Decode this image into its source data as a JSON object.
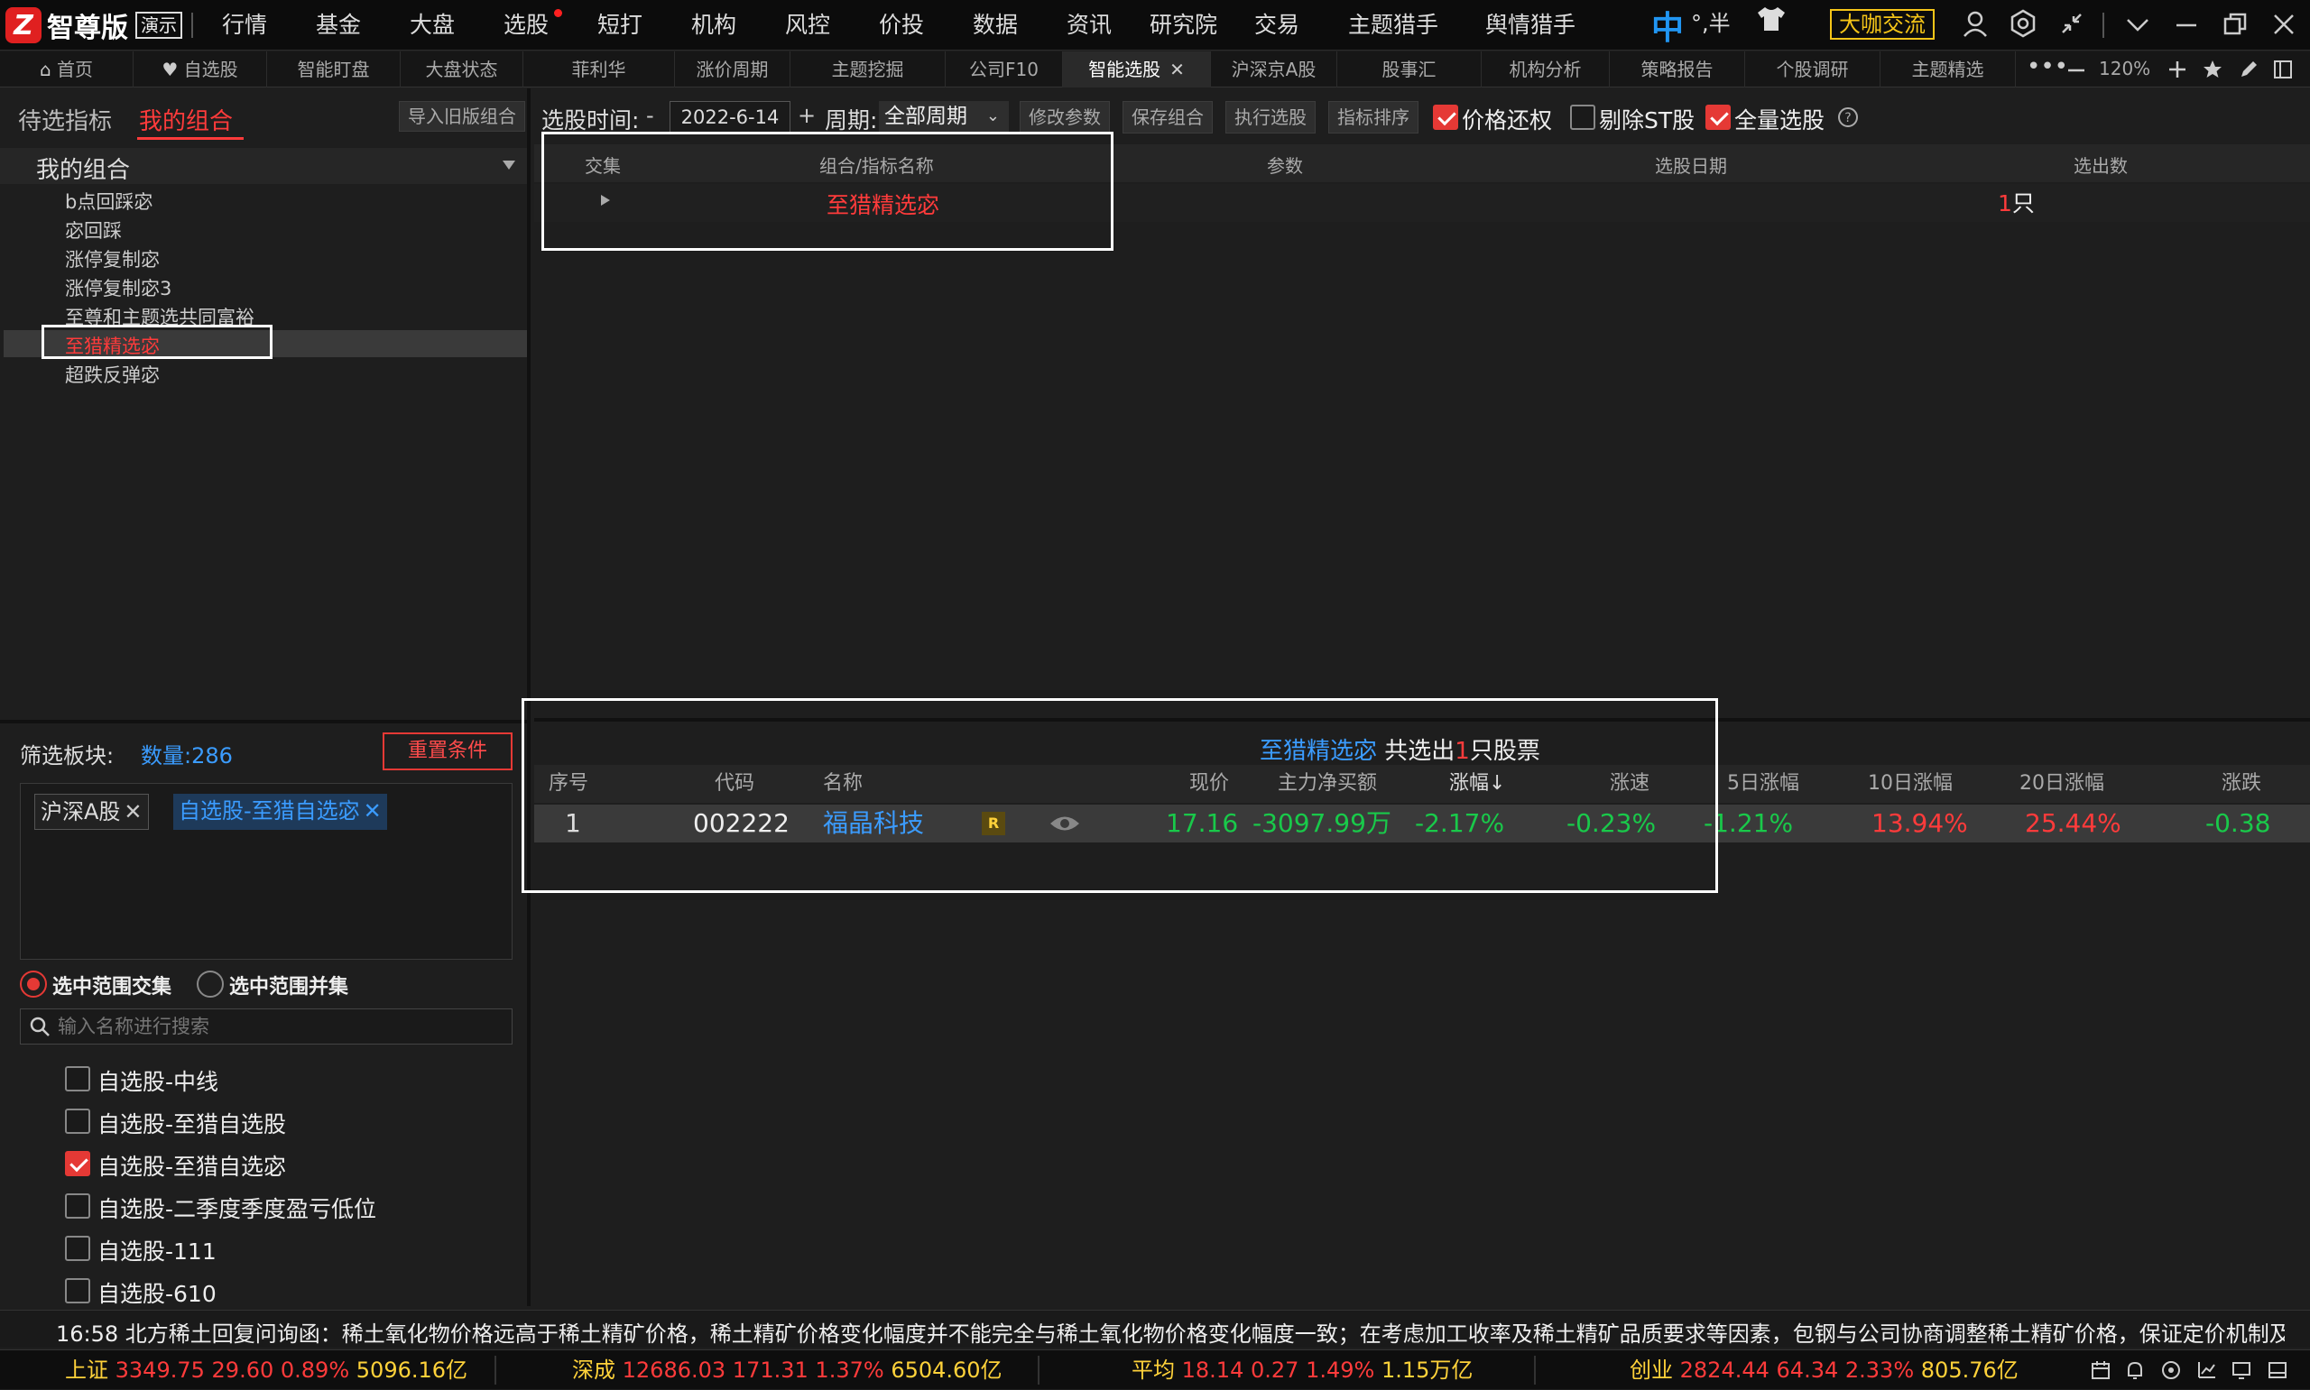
{
  "app": {
    "brand": "智尊版",
    "badge": "演示"
  },
  "menu": [
    "行情",
    "基金",
    "大盘",
    "选股",
    "短打",
    "机构",
    "风控",
    "价投",
    "数据",
    "资讯",
    "研究院",
    "交易",
    "主题猎手",
    "舆情猎手"
  ],
  "top_right": {
    "ime": "中",
    "ime2": "°,半",
    "expert": "大咖交流"
  },
  "tabs": [
    "首页",
    "自选股",
    "智能盯盘",
    "大盘状态",
    "菲利华",
    "涨价周期",
    "主题挖掘",
    "公司F10",
    "智能选股",
    "沪深京A股",
    "股事汇",
    "机构分析",
    "策略报告",
    "个股调研",
    "主题精选"
  ],
  "tab_zoom": "120%",
  "left": {
    "tab1": "待选指标",
    "tab2": "我的组合",
    "import_btn": "导入旧版组合",
    "group_title": "我的组合",
    "items": [
      "b点回踩宓",
      "宓回踩",
      "涨停复制宓",
      "涨停复制宓3",
      "至尊和主题选共同富裕",
      "至猎精选宓",
      "超跌反弹宓"
    ],
    "filter_label": "筛选板块:",
    "count_label": "数量:286",
    "reset_btn": "重置条件",
    "tag1": "沪深A股",
    "tag2": "自选股-至猎自选宓",
    "radio1": "选中范围交集",
    "radio2": "选中范围并集",
    "search_placeholder": "输入名称进行搜索",
    "list": [
      {
        "label": "自选股-中线",
        "checked": false
      },
      {
        "label": "自选股-至猎自选股",
        "checked": false
      },
      {
        "label": "自选股-至猎自选宓",
        "checked": true
      },
      {
        "label": "自选股-二季度季度盈亏低位",
        "checked": false
      },
      {
        "label": "自选股-111",
        "checked": false
      },
      {
        "label": "自选股-610",
        "checked": false
      }
    ]
  },
  "toolbar": {
    "time_label": "选股时间:",
    "minus": "-",
    "date": "2022-6-14",
    "plus": "+",
    "period_label": "周期:",
    "period_value": "全部周期",
    "btn_modify": "修改参数",
    "btn_save": "保存组合",
    "btn_run": "执行选股",
    "btn_sort": "指标排序",
    "chk_price": "价格还权",
    "chk_st": "剔除ST股",
    "chk_full": "全量选股"
  },
  "combo_table": {
    "headers": [
      "交集",
      "组合/指标名称",
      "参数",
      "选股日期",
      "选出数"
    ],
    "row": {
      "name": "至猎精选宓",
      "count_num": "1",
      "count_unit": "只"
    }
  },
  "result": {
    "title_name": "至猎精选宓",
    "title_mid": " 共选出",
    "title_num": "1",
    "title_end": "只股票",
    "headers": [
      "序号",
      "代码",
      "名称",
      "",
      "",
      "现价",
      "主力净买额",
      "涨幅↓",
      "涨速",
      "5日涨幅",
      "10日涨幅",
      "20日涨幅",
      "涨跌"
    ],
    "row": {
      "idx": "1",
      "code": "002222",
      "name": "福晶科技",
      "badge": "R",
      "price": "17.16",
      "net": "-3097.99万",
      "chg": "-2.17%",
      "speed": "-0.23%",
      "d5": "-1.21%",
      "d10": "13.94%",
      "d20": "25.44%",
      "diff": "-0.38"
    }
  },
  "ticker": "16:58 北方稀土回复问询函：稀土氧化物价格远高于稀土精矿价格，稀土精矿价格变化幅度并不能完全与稀土氧化物价格变化幅度一致；在考虑加工收率及稀土精矿品质要求等因素，包钢与公司协商调整稀土精矿价格，保证定价机制及",
  "status": [
    {
      "name": "上证",
      "val": "3349.75",
      "chg": "29.60",
      "pct": "0.89%",
      "amt": "5096.16亿"
    },
    {
      "name": "深成",
      "val": "12686.03",
      "chg": "171.31",
      "pct": "1.37%",
      "amt": "6504.60亿"
    },
    {
      "name": "平均",
      "val": "18.14",
      "chg": "0.27",
      "pct": "1.49%",
      "amt": "1.15万亿"
    },
    {
      "name": "创业",
      "val": "2824.44",
      "chg": "64.34",
      "pct": "2.33%",
      "amt": "805.76亿"
    }
  ]
}
